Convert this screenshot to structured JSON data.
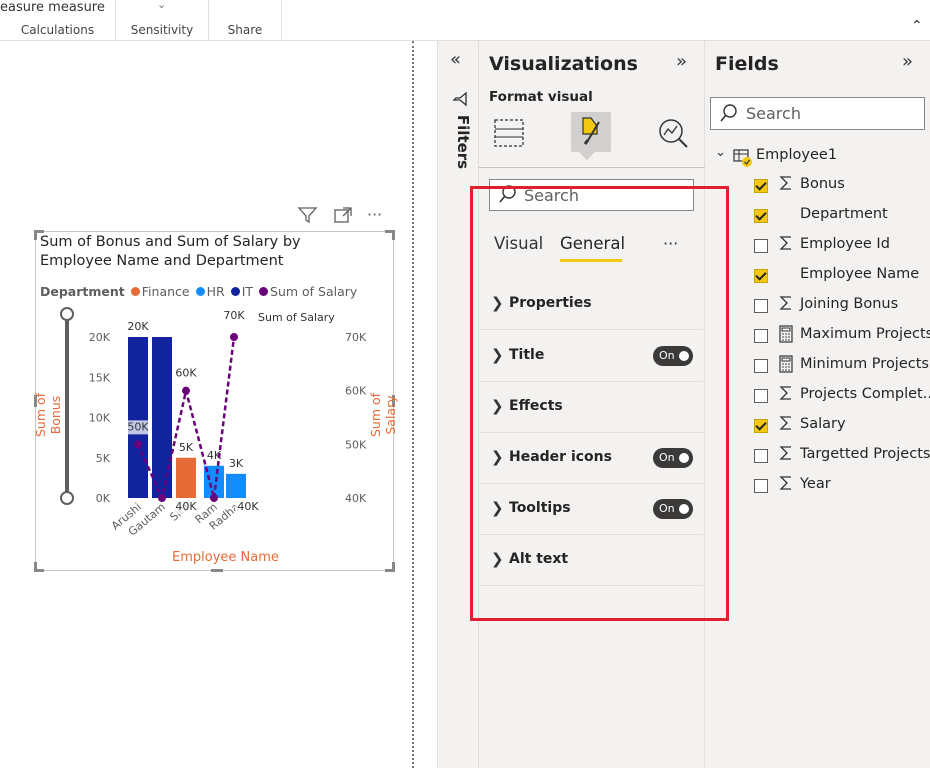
{
  "ribbon": {
    "top_text": "easure measure",
    "groups": [
      {
        "label": "Calculations"
      },
      {
        "label": "Sensitivity"
      },
      {
        "label": "Share"
      }
    ]
  },
  "filters_pane": {
    "label": "Filters"
  },
  "visualizations": {
    "title": "Visualizations",
    "format_label": "Format visual",
    "search_placeholder": "Search",
    "tabs": [
      "Visual",
      "General"
    ],
    "more": "···",
    "sections": [
      {
        "label": "Properties",
        "toggle": null
      },
      {
        "label": "Title",
        "toggle": "On"
      },
      {
        "label": "Effects",
        "toggle": null
      },
      {
        "label": "Header icons",
        "toggle": "On"
      },
      {
        "label": "Tooltips",
        "toggle": "On"
      },
      {
        "label": "Alt text",
        "toggle": null
      }
    ]
  },
  "fields": {
    "title": "Fields",
    "search_placeholder": "Search",
    "table_name": "Employee1",
    "items": [
      {
        "label": "Bonus",
        "checked": true,
        "icon": "sigma"
      },
      {
        "label": "Department",
        "checked": true,
        "icon": ""
      },
      {
        "label": "Employee Id",
        "checked": false,
        "icon": "sigma"
      },
      {
        "label": "Employee Name",
        "checked": true,
        "icon": ""
      },
      {
        "label": "Joining Bonus",
        "checked": false,
        "icon": "sigma"
      },
      {
        "label": "Maximum Projects",
        "checked": false,
        "icon": "calc"
      },
      {
        "label": "Minimum Projects",
        "checked": false,
        "icon": "calc"
      },
      {
        "label": "Projects Complet...",
        "checked": false,
        "icon": "sigma"
      },
      {
        "label": "Salary",
        "checked": true,
        "icon": "sigma"
      },
      {
        "label": "Targetted Projects",
        "checked": false,
        "icon": "sigma"
      },
      {
        "label": "Year",
        "checked": false,
        "icon": "sigma"
      }
    ]
  },
  "colors": {
    "finance": "#e66c37",
    "hr": "#118dff",
    "it": "#12239e",
    "salary": "#6b007b",
    "highlight": "#e0202e",
    "axis_title": "#e66c37"
  },
  "chart_data": {
    "type": "bar",
    "title": "Sum of Bonus and Sum of Salary by Employee Name and Department",
    "legend_title": "Department",
    "legend": [
      "Finance",
      "HR",
      "IT",
      "Sum of Salary"
    ],
    "xlabel": "Employee Name",
    "ylabel": "Sum of Bonus",
    "y2label": "Sum of Salary",
    "y2_series_label": "Sum of Salary",
    "categories": [
      "Arushi",
      "Gautam",
      "Sita",
      "Ram",
      "Radha"
    ],
    "ylim": [
      0,
      20000
    ],
    "y_ticks": [
      "0K",
      "5K",
      "10K",
      "15K",
      "20K"
    ],
    "y2lim": [
      40000,
      70000
    ],
    "y2_ticks": [
      "40K",
      "50K",
      "60K",
      "70K"
    ],
    "series": [
      {
        "name": "IT",
        "values": [
          20000,
          20000,
          null,
          null,
          null
        ]
      },
      {
        "name": "Finance",
        "values": [
          null,
          null,
          5000,
          null,
          null
        ]
      },
      {
        "name": "HR",
        "values": [
          null,
          null,
          null,
          4000,
          3000
        ]
      }
    ],
    "bar_labels": [
      "20K",
      "5K",
      "4K",
      "3K"
    ],
    "line": {
      "name": "Sum of Salary",
      "values": [
        50000,
        40000,
        60000,
        40000,
        70000
      ]
    },
    "line_labels": [
      "50K",
      "40K",
      "60K",
      "40K",
      "70K"
    ]
  }
}
